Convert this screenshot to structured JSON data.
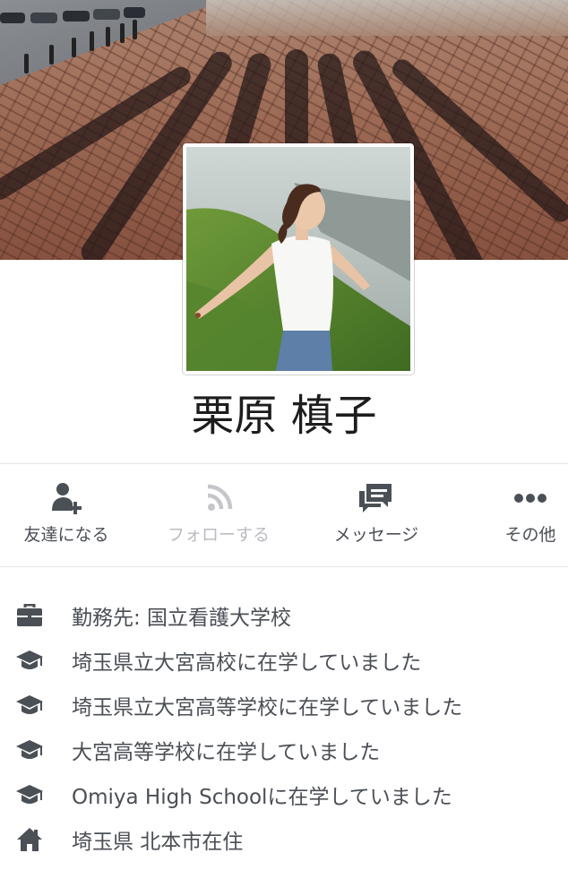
{
  "profile": {
    "name": "栗原 槙子"
  },
  "actions": [
    {
      "label": "友達になる",
      "icon": "add-friend-icon",
      "enabled": true
    },
    {
      "label": "フォローする",
      "icon": "follow-rss-icon",
      "enabled": false
    },
    {
      "label": "メッセージ",
      "icon": "message-icon",
      "enabled": true
    },
    {
      "label": "その他",
      "icon": "more-icon",
      "enabled": true
    }
  ],
  "intro": [
    {
      "icon": "briefcase-icon",
      "text": "勤務先: 国立看護大学校"
    },
    {
      "icon": "graduation-cap-icon",
      "text": "埼玉県立大宮高校に在学していました"
    },
    {
      "icon": "graduation-cap-icon",
      "text": "埼玉県立大宮高等学校に在学していました"
    },
    {
      "icon": "graduation-cap-icon",
      "text": "大宮高等学校に在学していました"
    },
    {
      "icon": "graduation-cap-icon",
      "text": "Omiya High Schoolに在学していました"
    },
    {
      "icon": "home-icon",
      "text": "埼玉県 北本市在住"
    }
  ],
  "colors": {
    "icon": "#4b4f56",
    "icon_disabled": "#c4c6ca",
    "text": "#4b4f56",
    "name": "#1d1d1d"
  }
}
